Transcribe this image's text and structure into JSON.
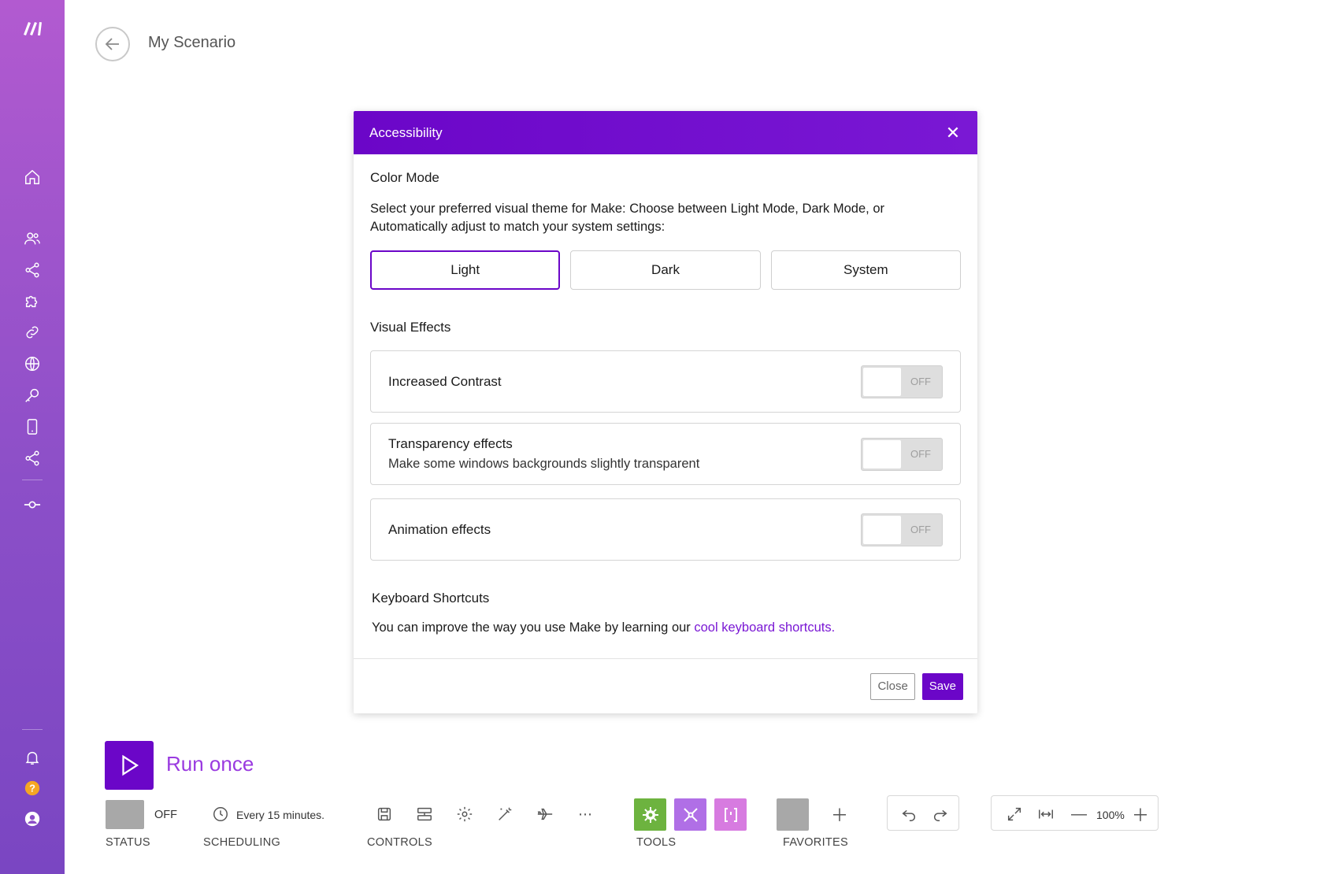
{
  "header": {
    "title": "My Scenario"
  },
  "modal": {
    "title": "Accessibility",
    "color_mode": {
      "title": "Color Mode",
      "description": "Select your preferred visual theme for Make: Choose between Light Mode, Dark Mode, or Automatically adjust to match your system settings:",
      "options": [
        "Light",
        "Dark",
        "System"
      ],
      "selected": "Light"
    },
    "visual_effects": {
      "title": "Visual Effects",
      "items": [
        {
          "label": "Increased Contrast",
          "sub": "",
          "state": "OFF"
        },
        {
          "label": "Transparency effects",
          "sub": "Make some windows backgrounds slightly transparent",
          "state": "OFF"
        },
        {
          "label": "Animation effects",
          "sub": "",
          "state": "OFF"
        }
      ]
    },
    "keyboard": {
      "title": "Keyboard Shortcuts",
      "text": "You can improve the way you use Make by learning our ",
      "link": "cool keyboard shortcuts."
    },
    "footer": {
      "close_label": "Close",
      "save_label": "Save"
    }
  },
  "toolbar": {
    "run_label": "Run once",
    "status_value": "OFF",
    "status_caption": "STATUS",
    "schedule_value": "Every 15 minutes.",
    "schedule_caption": "SCHEDULING",
    "controls_caption": "CONTROLS",
    "tools_caption": "TOOLS",
    "favorites_caption": "FAVORITES",
    "zoom": "100%"
  },
  "colors": {
    "accent": "#6b06c8",
    "tool_green": "#6db33f",
    "tool_violet": "#b06fe6",
    "tool_pink": "#d77be0"
  },
  "sidebar": {
    "icons": [
      "logo",
      "home-icon",
      "team-icon",
      "share-icon",
      "puzzle-icon",
      "link-icon",
      "globe-icon",
      "key-icon",
      "mobile-icon",
      "flow-icon",
      "commit-icon",
      "bell-icon",
      "help-icon",
      "user-icon"
    ]
  }
}
